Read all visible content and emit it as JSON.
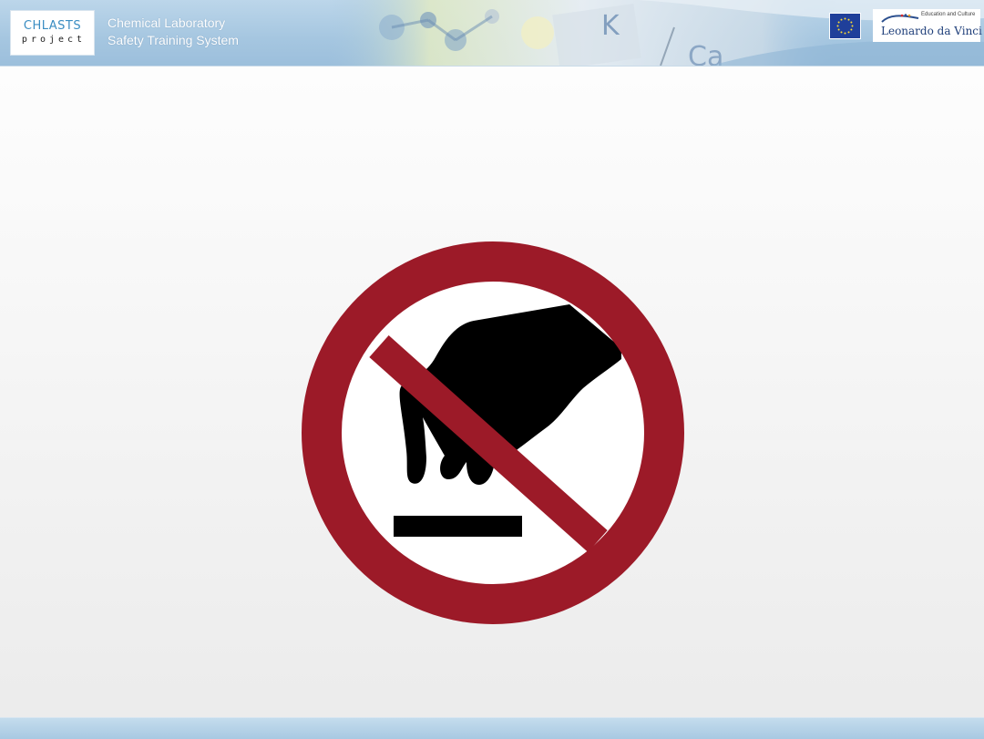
{
  "header": {
    "logo": {
      "line1": "CHLASTS",
      "line2": "project"
    },
    "title_line1": "Chemical Laboratory",
    "title_line2": "Safety Training System",
    "eu_flag_icon": "eu-flag-icon",
    "partner_logo": {
      "small_text": "Education and Culture",
      "name": "Leonardo da Vinci"
    }
  },
  "sign": {
    "icon": "do-not-touch-prohibition-icon",
    "ring_color": "#9c1a28",
    "symbol_color": "#000000"
  },
  "colors": {
    "header_blue": "#a5c6e0",
    "footer_blue": "#aecde4",
    "background": "#f3f3f3"
  }
}
